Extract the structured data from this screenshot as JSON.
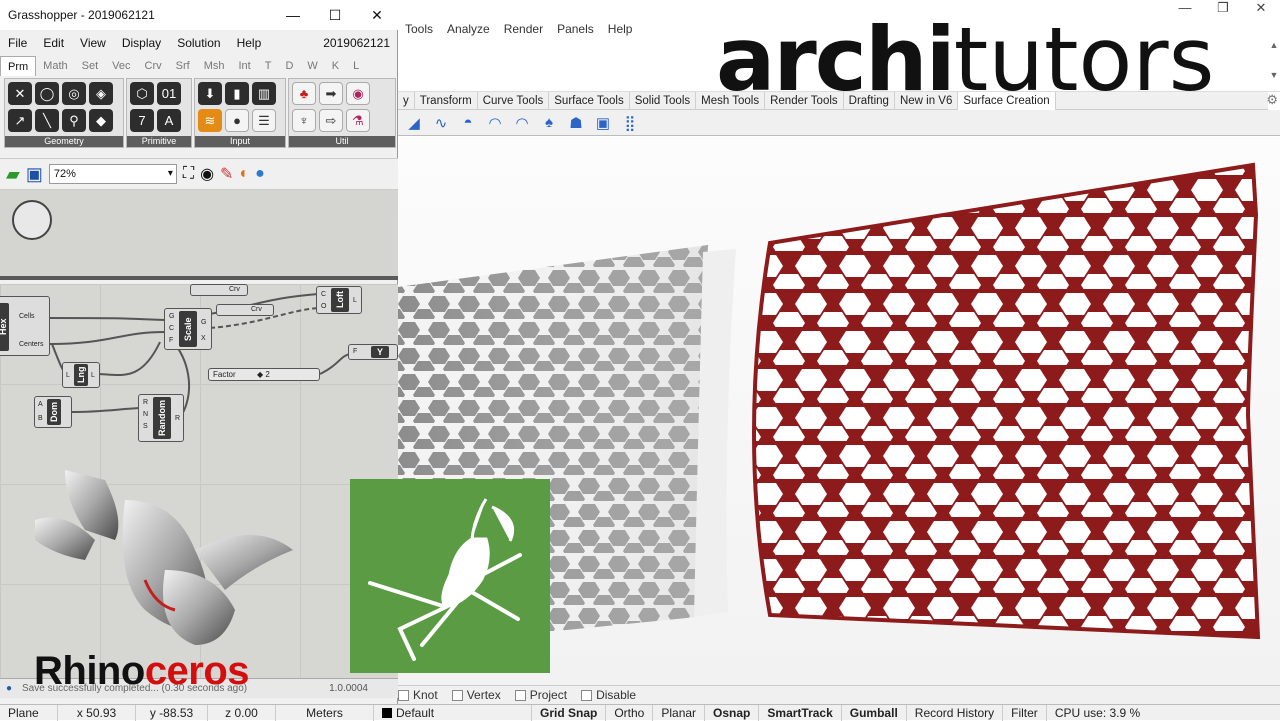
{
  "rhino": {
    "menu": [
      "Tools",
      "Analyze",
      "Render",
      "Panels",
      "Help"
    ],
    "tabs": [
      "y",
      "Transform",
      "Curve Tools",
      "Surface Tools",
      "Solid Tools",
      "Mesh Tools",
      "Render Tools",
      "Drafting",
      "New in V6",
      "Surface Creation"
    ],
    "osnaps": [
      "Knot",
      "Vertex",
      "Project",
      "Disable"
    ],
    "status": {
      "plane": "Plane",
      "x": "x 50.93",
      "y": "y -88.53",
      "z": "z 0.00",
      "units": "Meters",
      "layer": "Default",
      "grid_snap": "Grid Snap",
      "ortho": "Ortho",
      "planar": "Planar",
      "osnap": "Osnap",
      "smarttrack": "SmartTrack",
      "gumball": "Gumball",
      "record_history": "Record History",
      "filter": "Filter",
      "cpu": "CPU use: 3.9 %"
    }
  },
  "logo": {
    "bold": "archi",
    "thin": "tutors"
  },
  "grasshopper": {
    "title": "Grasshopper - 2019062121",
    "menu": [
      "File",
      "Edit",
      "View",
      "Display",
      "Solution",
      "Help"
    ],
    "version": "2019062121",
    "tabs": [
      "Prm",
      "Math",
      "Set",
      "Vec",
      "Crv",
      "Srf",
      "Msh",
      "Int",
      "T",
      "D",
      "W",
      "K",
      "L"
    ],
    "groups": [
      "Geometry",
      "Primitive",
      "Input",
      "Util"
    ],
    "zoom": "72%",
    "nodes": {
      "hex": "Hex",
      "cells": "Cells",
      "centers": "Centers",
      "scale": "Scale",
      "loft": "Loft",
      "lng": "Lng",
      "dom": "Dom",
      "random": "Random",
      "crv1": "Crv",
      "crv2": "Crv",
      "factor": "Factor",
      "factor_value": "◆ 2"
    },
    "status_text": "Save successfully completed... (0.30 seconds ago)",
    "status_version": "1.0.0004"
  },
  "overlays": {
    "rhino_a": "Rhino",
    "rhino_b": "ceros"
  }
}
